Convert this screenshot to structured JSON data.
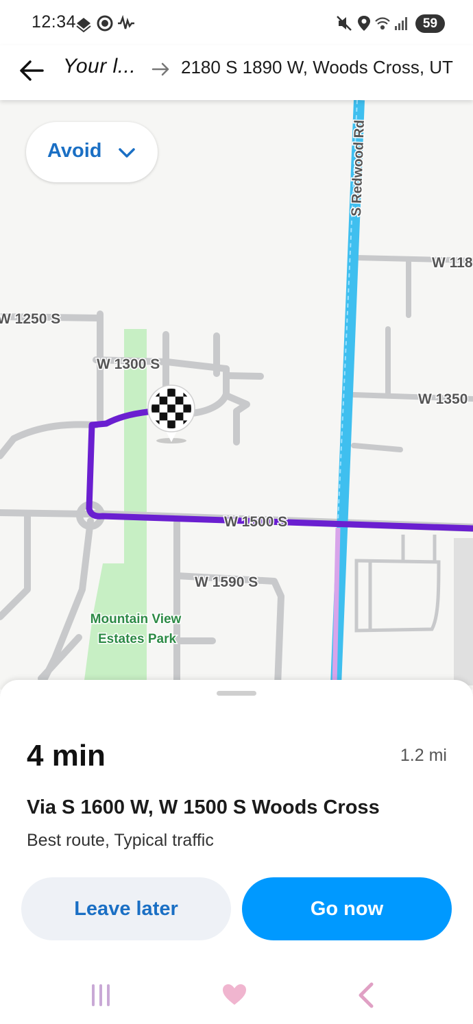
{
  "status_bar": {
    "time": "12:34",
    "battery": "59"
  },
  "header": {
    "origin": "Your l...",
    "destination": "2180 S 1890 W, Woods Cross, UT"
  },
  "map": {
    "avoid_label": "Avoid",
    "street_labels": {
      "redwood": "S Redwood Rd",
      "w1250": "W 1250 S",
      "w1300": "W 1300 S",
      "w1180": "W 118",
      "w1350": "W 1350",
      "w1500": "W 1500 S",
      "w1590": "W 1590 S"
    },
    "park_label_line1": "Mountain View",
    "park_label_line2": "Estates Park",
    "colors": {
      "route": "#6a1fd0",
      "highway": "#3fbfef",
      "park": "#c7efc4"
    }
  },
  "route_card": {
    "eta": "4 min",
    "distance": "1.2 mi",
    "via": "Via S 1600 W, W 1500 S Woods Cross",
    "description": "Best route, Typical traffic",
    "leave_later_label": "Leave later",
    "go_now_label": "Go now"
  },
  "icons": {
    "back": "arrow-left-icon",
    "route_arrow": "arrow-right-icon",
    "avoid": "chevron-down-icon",
    "pin": "checkered-flag-pin-icon"
  }
}
